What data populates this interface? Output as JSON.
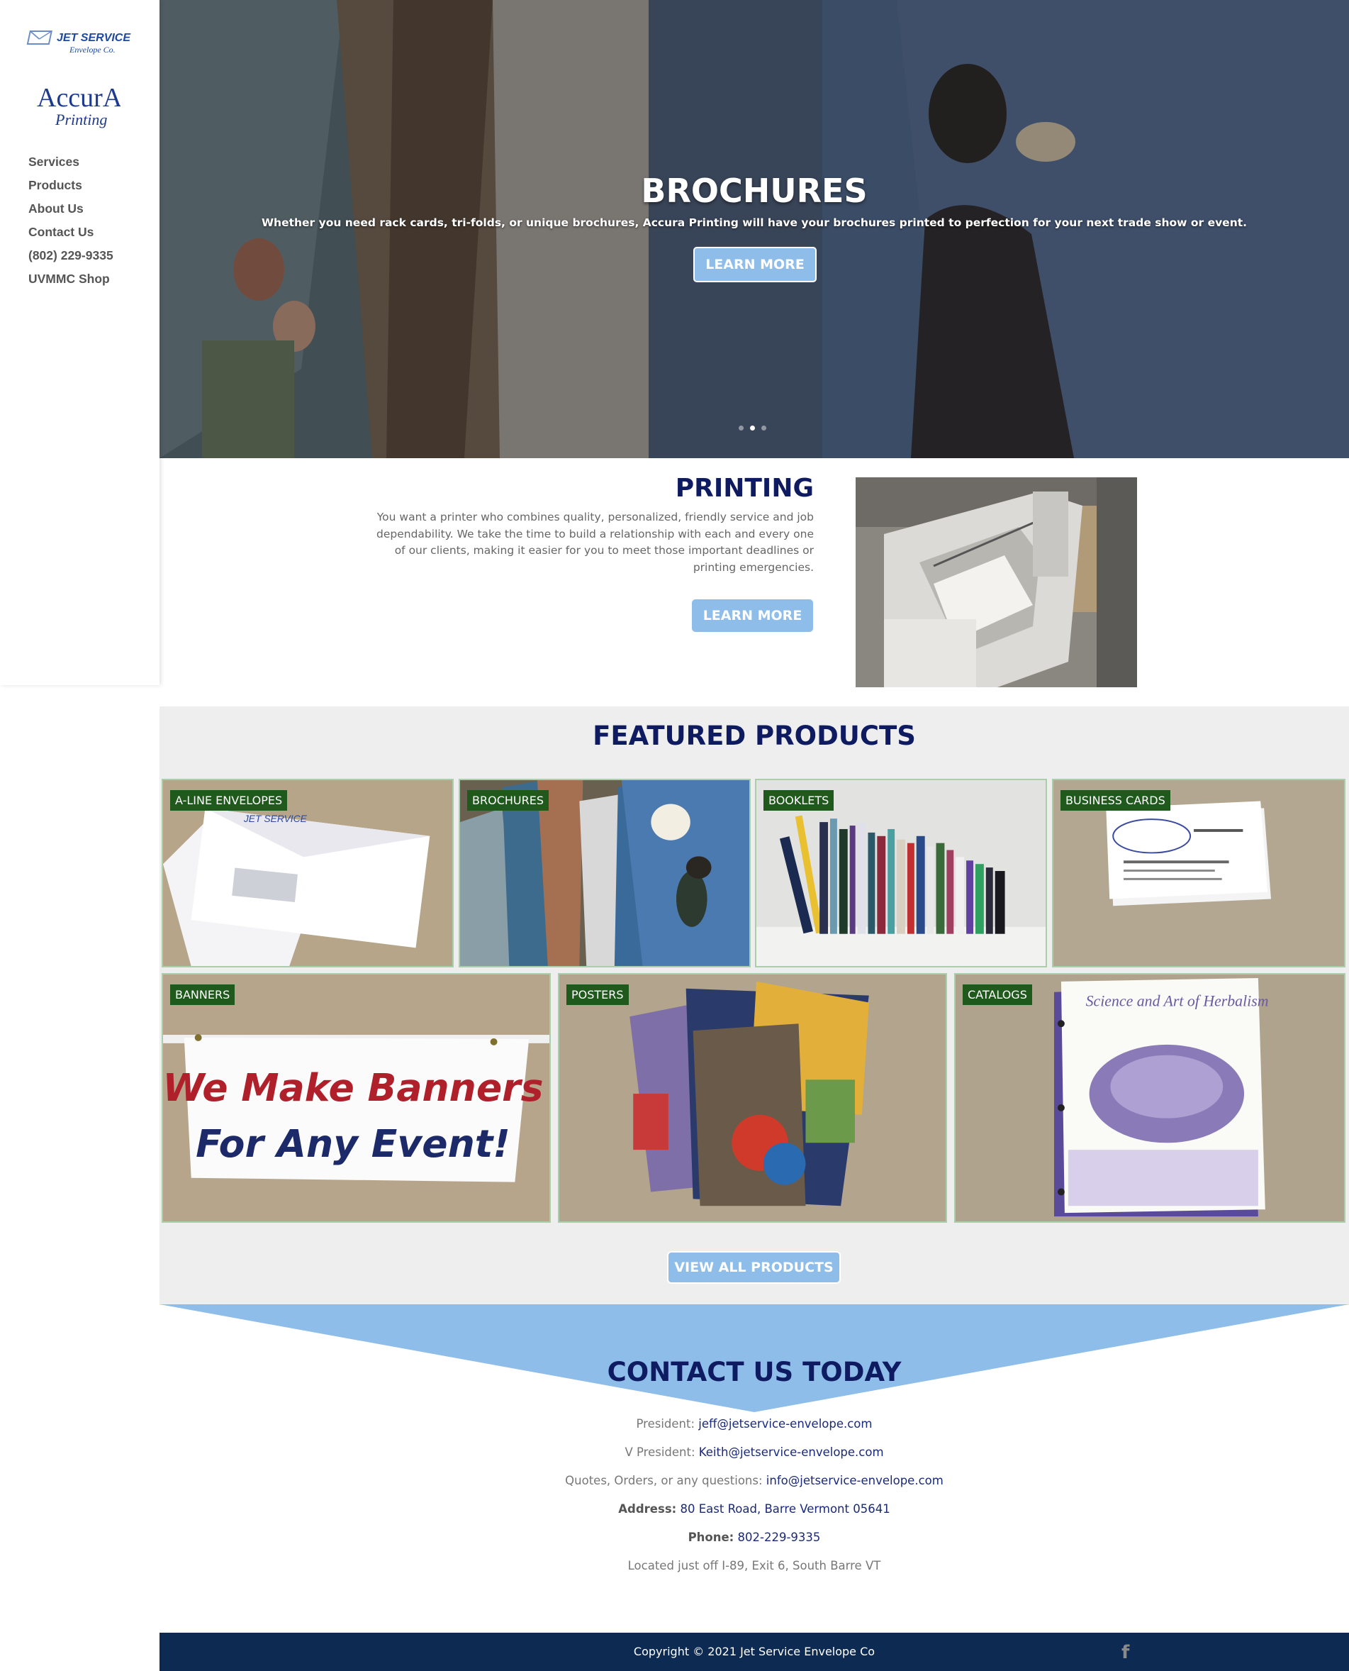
{
  "sidebar": {
    "logo_jet_line1": "JET SERVICE",
    "logo_jet_line2": "Envelope Co.",
    "logo_accura_line1": "AccurA",
    "logo_accura_line2": "Printing",
    "nav": [
      {
        "label": "Services"
      },
      {
        "label": "Products"
      },
      {
        "label": "About Us"
      },
      {
        "label": "Contact Us"
      },
      {
        "label": "(802) 229-9335"
      },
      {
        "label": "UVMMC Shop"
      }
    ]
  },
  "hero": {
    "title": "BROCHURES",
    "text": "Whether you need rack cards, tri-folds, or unique brochures, Accura Printing will have your brochures printed to perfection for your next trade show or event.",
    "button": "LEARN MORE",
    "active_slide": 2,
    "slide_count": 3
  },
  "printing": {
    "title": "PRINTING",
    "text": "You want a printer who combines quality, personalized, friendly service and job dependability. We take the time to build a relationship with each and every one of our clients, making it easier for you to meet those important deadlines or printing emergencies.",
    "button": "LEARN MORE"
  },
  "featured": {
    "title": "FEATURED PRODUCTS",
    "products": [
      {
        "label": "A-LINE ENVELOPES"
      },
      {
        "label": "BROCHURES"
      },
      {
        "label": "BOOKLETS"
      },
      {
        "label": "BUSINESS CARDS"
      },
      {
        "label": "BANNERS"
      },
      {
        "label": "POSTERS"
      },
      {
        "label": "CATALOGS"
      }
    ],
    "banner_text_1": "We Make Banners",
    "banner_text_2": "For Any Event!",
    "button": "VIEW ALL PRODUCTS"
  },
  "contact": {
    "title": "CONTACT US TODAY",
    "president_label": "President: ",
    "president_email": "jeff@jetservice-envelope.com",
    "vp_label": "V President: ",
    "vp_email": "Keith@jetservice-envelope.com",
    "quotes_label": "Quotes, Orders, or any questions: ",
    "quotes_email": "info@jetservice-envelope.com",
    "address_label": "Address:",
    "address": " 80 East Road, Barre Vermont 05641",
    "phone_label": "Phone:",
    "phone": " 802-229-9335",
    "location": "Located just off I-89, Exit 6, South Barre VT"
  },
  "footer": {
    "copyright": "Copyright © 2021 Jet Service Envelope Co",
    "social_icon": "facebook-icon"
  },
  "colors": {
    "navy": "#0f1b60",
    "accent_blue": "#8ebdea",
    "label_green": "#1f5a1c",
    "footer_bg": "#0d2a52"
  }
}
